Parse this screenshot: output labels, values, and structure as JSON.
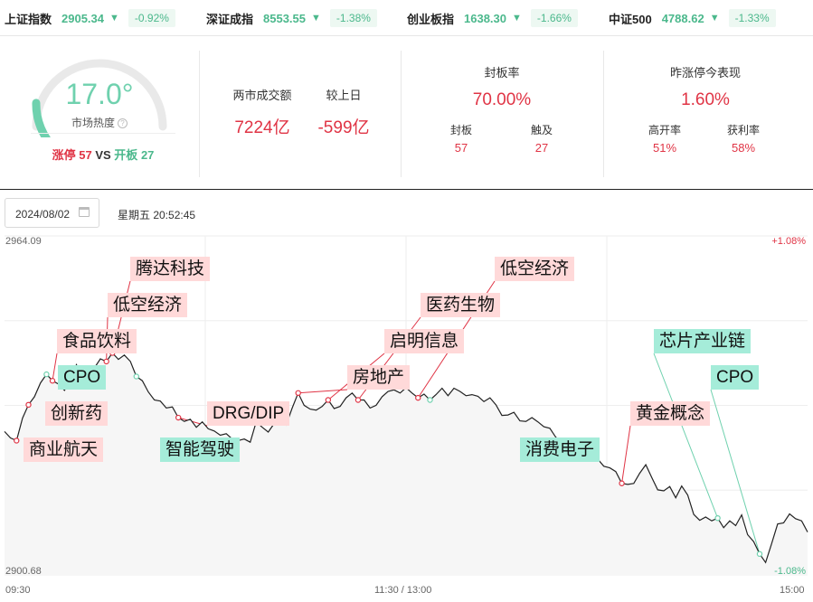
{
  "ticker": [
    {
      "name": "上证指数",
      "value": "2905.34",
      "arrow": "▼",
      "pct": "-0.92%"
    },
    {
      "name": "深证成指",
      "value": "8553.55",
      "arrow": "▼",
      "pct": "-1.38%"
    },
    {
      "name": "创业板指",
      "value": "1638.30",
      "arrow": "▼",
      "pct": "-1.66%"
    },
    {
      "name": "中证500",
      "value": "4788.62",
      "arrow": "▼",
      "pct": "-1.33%"
    }
  ],
  "heat": {
    "value": "17.0°",
    "gauge_level": 0.17,
    "label": "市场热度",
    "help_icon": "?",
    "limit_up_label": "涨停",
    "limit_up": "57",
    "vs": "VS",
    "open_board_label": "开板",
    "open_board": "27"
  },
  "volume": {
    "label": "两市成交额",
    "value": "7224亿",
    "compare_label": "较上日",
    "compare_value": "-599亿"
  },
  "seal_rate": {
    "label": "封板率",
    "value": "70.00%",
    "sealed_label": "封板",
    "sealed": "57",
    "touched_label": "触及",
    "touched": "27"
  },
  "yesterday": {
    "label": "昨涨停今表现",
    "value": "1.60%",
    "high_open_label": "高开率",
    "high_open": "51%",
    "profit_label": "获利率",
    "profit": "58%"
  },
  "date": {
    "value": "2024/08/02",
    "weekday_time": "星期五 20:52:45",
    "calendar_icon": "calendar-icon"
  },
  "chart_data": {
    "type": "line",
    "y_max_label": "2964.09",
    "y_min_label": "2900.68",
    "pct_max_label": "+1.08%",
    "pct_min_label": "-1.08%",
    "ylim": [
      2900.68,
      2964.09
    ],
    "x_labels": [
      "09:30",
      "11:30 / 13:00",
      "15:00"
    ],
    "series_values": [
      2927.5,
      2926.3,
      2925.8,
      2930.0,
      2932.5,
      2934.0,
      2936.6,
      2938.2,
      2937.0,
      2936.4,
      2935.2,
      2937.2,
      2940.0,
      2937.8,
      2938.2,
      2939.4,
      2941.1,
      2940.6,
      2942.2,
      2941.0,
      2941.8,
      2940.6,
      2937.8,
      2937.0,
      2934.9,
      2933.4,
      2933.2,
      2931.9,
      2932.1,
      2930.1,
      2929.4,
      2929.8,
      2928.3,
      2929.3,
      2928.0,
      2927.6,
      2926.8,
      2927.1,
      2926.1,
      2925.8,
      2926.1,
      2925.5,
      2929.3,
      2928.3,
      2927.4,
      2929.0,
      2931.1,
      2928.8,
      2931.9,
      2934.7,
      2932.4,
      2931.7,
      2931.5,
      2932.2,
      2933.4,
      2931.8,
      2932.2,
      2933.8,
      2934.7,
      2933.4,
      2933.4,
      2931.9,
      2932.4,
      2934.0,
      2935.0,
      2935.3,
      2934.7,
      2935.7,
      2934.7,
      2933.8,
      2934.5,
      2933.4,
      2934.4,
      2935.6,
      2934.2,
      2935.6,
      2935.0,
      2934.2,
      2934.4,
      2934.1,
      2933.1,
      2933.8,
      2932.5,
      2930.5,
      2930.6,
      2931.1,
      2929.5,
      2929.4,
      2930.1,
      2929.3,
      2928.4,
      2928.1,
      2926.4,
      2925.5,
      2926.2,
      2925.3,
      2925.0,
      2925.3,
      2923.0,
      2922.3,
      2921.0,
      2920.7,
      2920.0,
      2917.8,
      2917.6,
      2917.8,
      2919.7,
      2921.3,
      2918.9,
      2916.6,
      2916.4,
      2917.2,
      2915.1,
      2917.3,
      2915.6,
      2912.0,
      2910.9,
      2911.5,
      2910.8,
      2911.3,
      2909.5,
      2910.8,
      2909.9,
      2911.9,
      2908.2,
      2906.9,
      2904.6,
      2903.0,
      2906.5,
      2910.2,
      2910.4,
      2912.1,
      2911.2,
      2910.8,
      2908.7
    ],
    "markers": [
      {
        "label": "商业航天",
        "color": "red"
      },
      {
        "label": "创新药",
        "color": "red"
      },
      {
        "label": "CPO",
        "color": "green"
      },
      {
        "label": "食品饮料",
        "color": "red"
      },
      {
        "label": "低空经济",
        "color": "red"
      },
      {
        "label": "腾达科技",
        "color": "red"
      },
      {
        "label": "智能驾驶",
        "color": "green"
      },
      {
        "label": "DRG/DIP",
        "color": "red"
      },
      {
        "label": "房地产",
        "color": "red"
      },
      {
        "label": "启明信息",
        "color": "red"
      },
      {
        "label": "医药生物",
        "color": "red"
      },
      {
        "label": "低空经济",
        "color": "red"
      },
      {
        "label": "消费电子",
        "color": "green"
      },
      {
        "label": "黄金概念",
        "color": "red"
      },
      {
        "label": "芯片产业链",
        "color": "green"
      },
      {
        "label": "CPO",
        "color": "green"
      }
    ]
  },
  "colors": {
    "up": "#e03445",
    "down": "#4bb88c",
    "heat": "#6fd1ae",
    "red_tag": "#ffd9d9",
    "green_tag": "#a5ecd9"
  }
}
